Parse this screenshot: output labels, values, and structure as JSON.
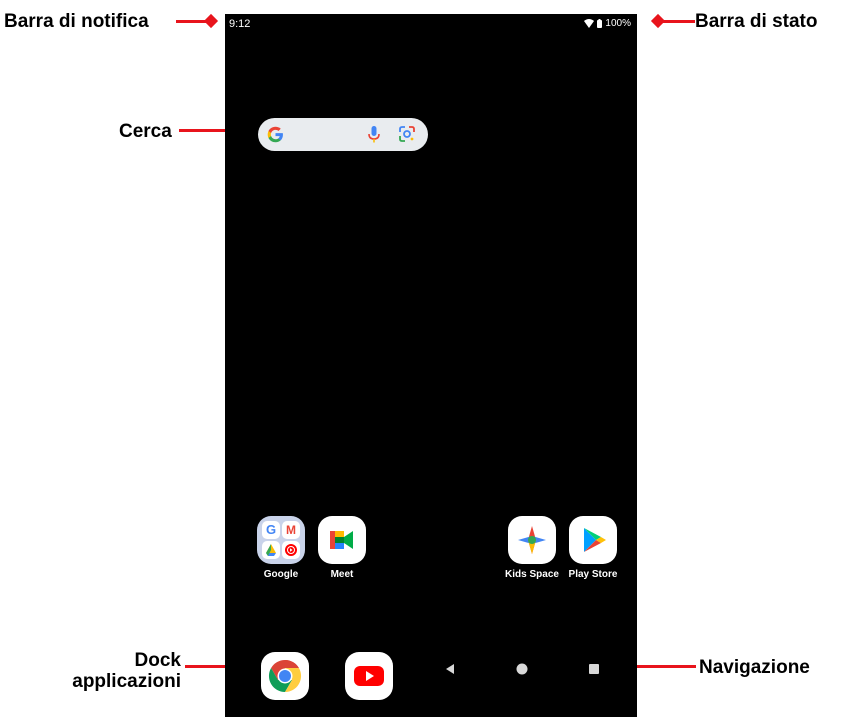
{
  "callouts": {
    "notification_bar": "Barra di notifica",
    "status_bar": "Barra di stato",
    "search": "Cerca",
    "dock_line1": "Dock",
    "dock_line2": "applicazioni",
    "navigation": "Navigazione"
  },
  "status": {
    "time": "9:12",
    "battery": "100%"
  },
  "apps": {
    "google": "Google",
    "meet": "Meet",
    "kids_space": "Kids Space",
    "play_store": "Play Store"
  },
  "colors": {
    "callout_accent": "#e8141c",
    "screen_background": "#000000",
    "search_bar": "#e9ecef",
    "folder_background": "#c9d3ea"
  },
  "icons": {
    "search": [
      "google-g-icon",
      "microphone-icon",
      "lens-icon"
    ],
    "dock": [
      "chrome-icon",
      "youtube-icon"
    ],
    "navigation": [
      "back-icon",
      "home-icon",
      "recents-icon"
    ]
  }
}
